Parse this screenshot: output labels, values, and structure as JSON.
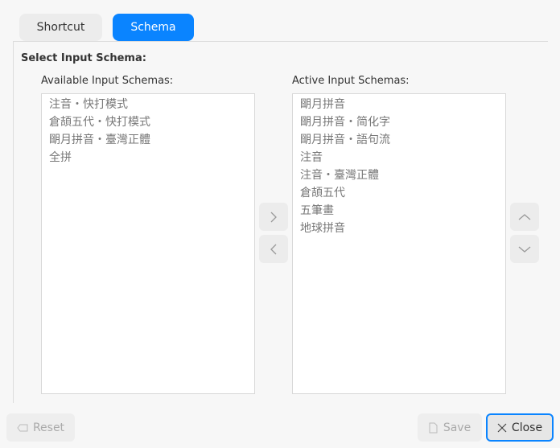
{
  "tabs": [
    {
      "label": "Shortcut"
    },
    {
      "label": "Schema"
    }
  ],
  "section_title": "Select Input Schema:",
  "available": {
    "label": "Available Input Schemas:",
    "items": [
      "注音・快打模式",
      "倉頡五代・快打模式",
      "朙月拼音・臺灣正體",
      "全拼"
    ]
  },
  "active": {
    "label": "Active Input Schemas:",
    "items": [
      "朙月拼音",
      "朙月拼音・简化字",
      "朙月拼音・語句流",
      "注音",
      "注音・臺灣正體",
      "倉頡五代",
      "五筆畫",
      "地球拼音"
    ]
  },
  "footer": {
    "reset": "Reset",
    "save": "Save",
    "close": "Close"
  }
}
